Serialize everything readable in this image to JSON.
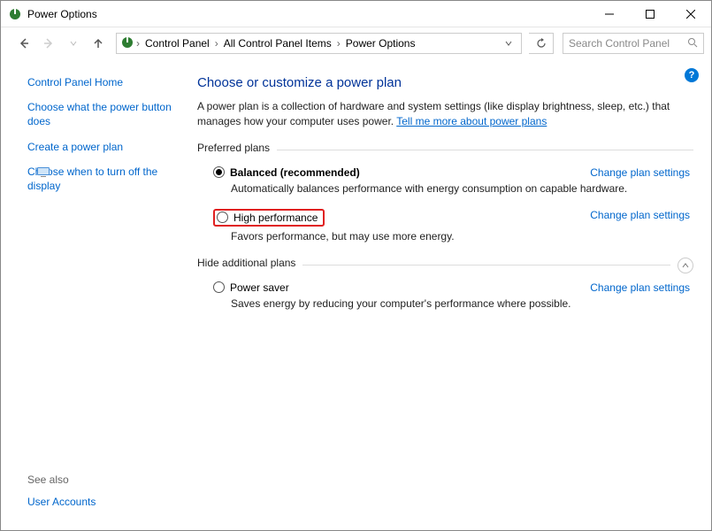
{
  "window": {
    "title": "Power Options"
  },
  "breadcrumb": {
    "seg1": "Control Panel",
    "seg2": "All Control Panel Items",
    "seg3": "Power Options"
  },
  "search": {
    "placeholder": "Search Control Panel"
  },
  "sidebar": {
    "home": "Control Panel Home",
    "choose_button": "Choose what the power button does",
    "create_plan": "Create a power plan",
    "turn_off_display": "Choose when to turn off the display",
    "see_also": "See also",
    "user_accounts": "User Accounts"
  },
  "main": {
    "heading": "Choose or customize a power plan",
    "desc_prefix": "A power plan is a collection of hardware and system settings (like display brightness, sleep, etc.) that manages how your computer uses power. ",
    "desc_link": "Tell me more about power plans",
    "preferred_label": "Preferred plans",
    "hide_label": "Hide additional plans",
    "change_link": "Change plan settings"
  },
  "plans": {
    "balanced": {
      "name": "Balanced (recommended)",
      "desc": "Automatically balances performance with energy consumption on capable hardware."
    },
    "high": {
      "name": "High performance",
      "desc": "Favors performance, but may use more energy."
    },
    "saver": {
      "name": "Power saver",
      "desc": "Saves energy by reducing your computer's performance where possible."
    }
  }
}
